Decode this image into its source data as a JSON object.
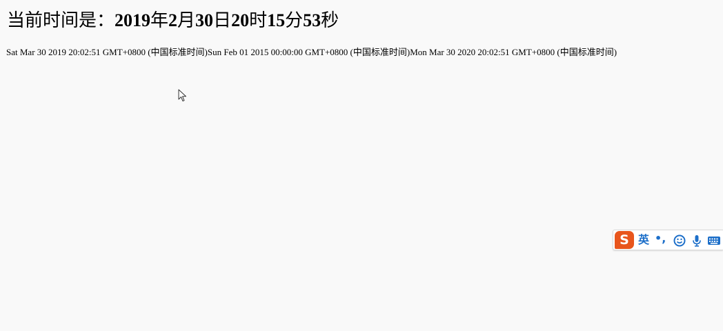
{
  "heading": {
    "prefix": "当前时间是：",
    "year": "2019",
    "year_unit": "年",
    "month": "2",
    "month_unit": "月",
    "day": "30",
    "day_unit": "日",
    "hour": "20",
    "hour_unit": "时",
    "minute": "15",
    "minute_unit": "分",
    "second": "53",
    "second_unit": "秒"
  },
  "dates_line": "Sat Mar 30 2019 20:02:51 GMT+0800 (中国标准时间)Sun Feb 01 2015 00:00:00 GMT+0800 (中国标准时间)Mon Mar 30 2020 20:02:51 GMT+0800 (中国标准时间)",
  "ime": {
    "logo": "S",
    "language": "英",
    "punctuation": "•,",
    "icons": [
      "emoji-icon",
      "microphone-icon",
      "keyboard-icon"
    ],
    "colors": {
      "logo": "#e8551c",
      "accent": "#1d6fc9"
    }
  }
}
